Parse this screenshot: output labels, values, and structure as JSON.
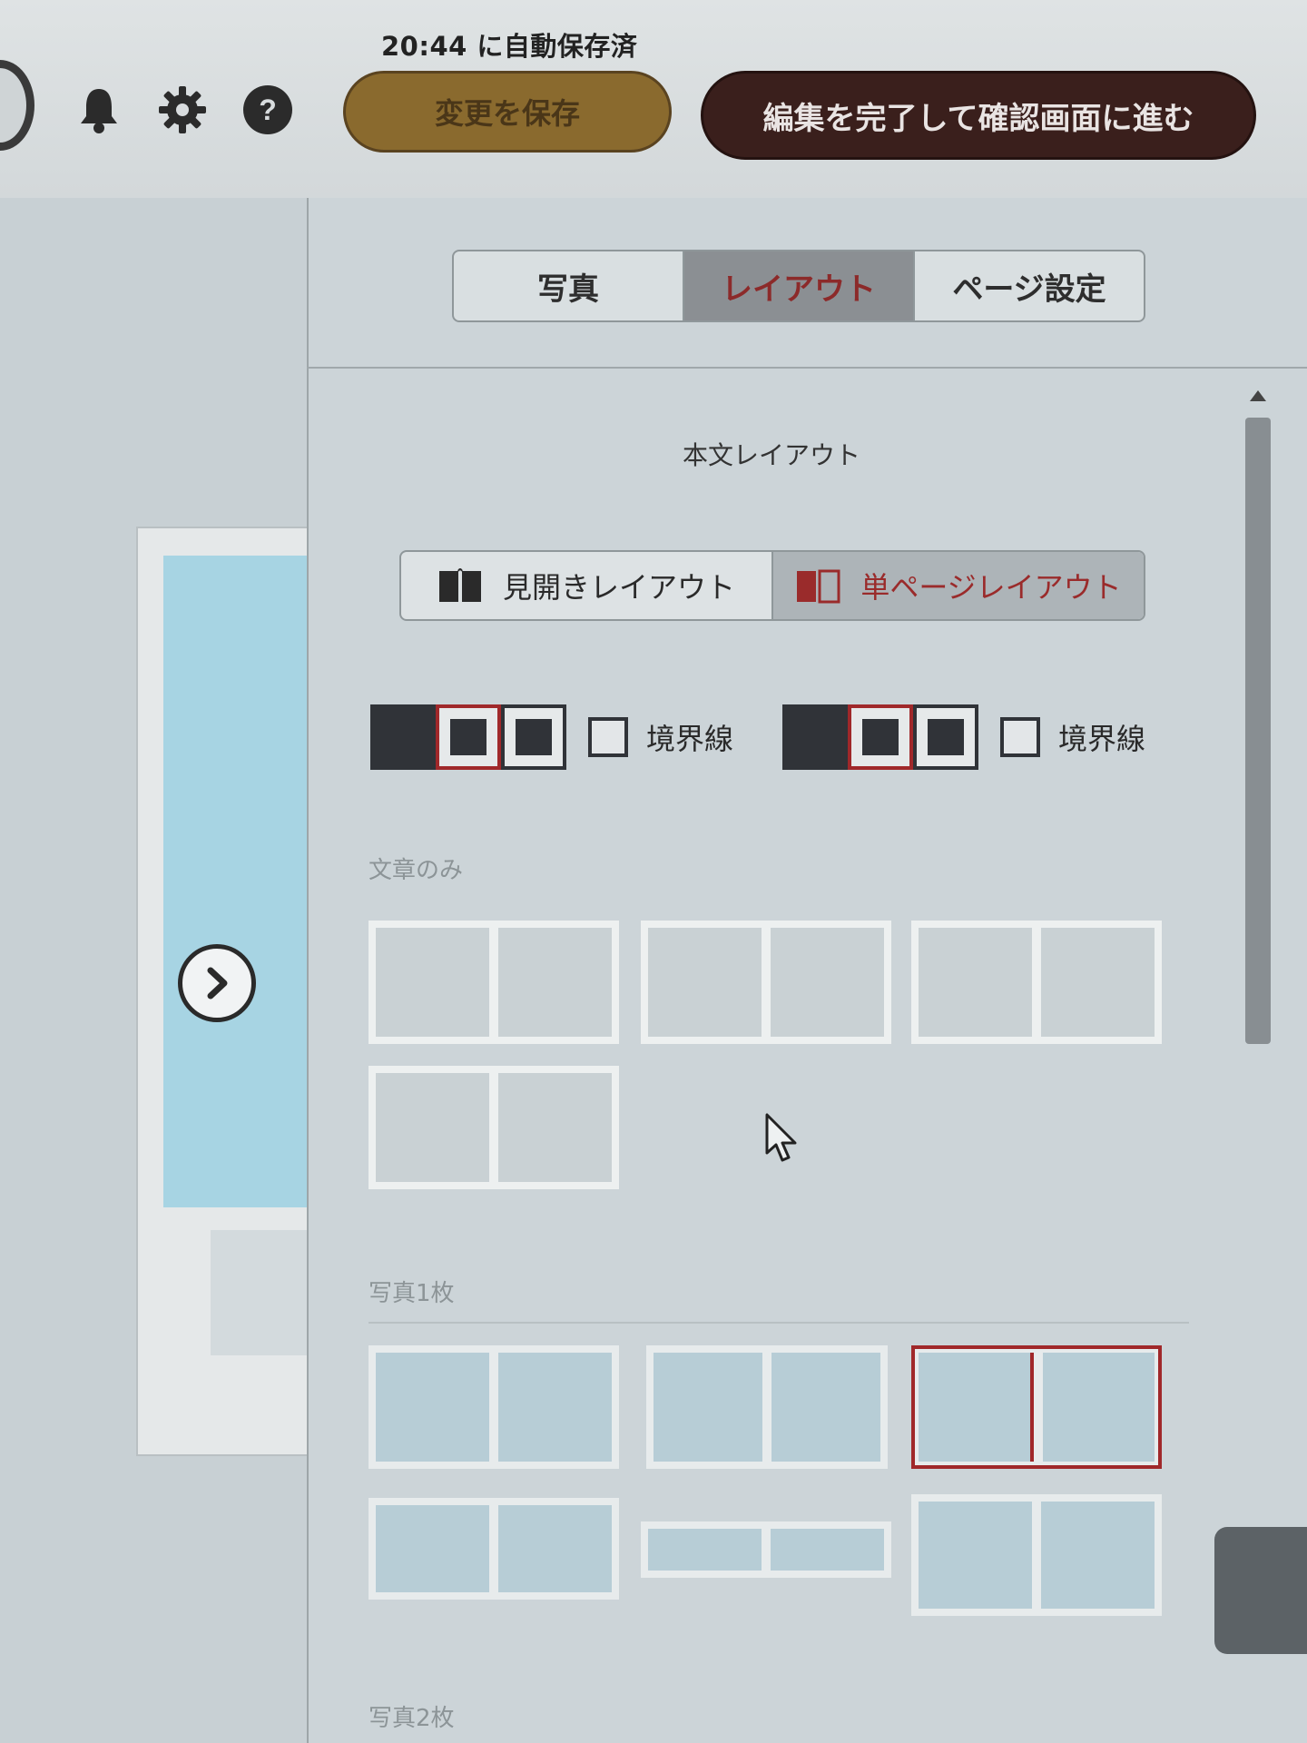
{
  "header": {
    "autosave_text": "20:44 に自動保存済",
    "save_button": "変更を保存",
    "finish_button": "編集を完了して確認画面に進む",
    "icons": [
      "bell-icon",
      "gear-icon",
      "help-icon"
    ]
  },
  "tabs": [
    {
      "label": "写真",
      "active": false
    },
    {
      "label": "レイアウト",
      "active": true
    },
    {
      "label": "ページ設定",
      "active": false
    }
  ],
  "panel": {
    "section_title": "本文レイアウト",
    "layout_modes": [
      {
        "label": "見開きレイアウト",
        "icon": "open-book-icon",
        "active": false
      },
      {
        "label": "単ページレイアウト",
        "icon": "single-page-icon",
        "active": true
      }
    ],
    "frame_options": [
      {
        "border_label": "境界線",
        "selected_frame": 1,
        "border_checked": false
      },
      {
        "border_label": "境界線",
        "selected_frame": 1,
        "border_checked": false
      }
    ],
    "groups": [
      {
        "label": "文章のみ"
      },
      {
        "label": "写真1枚"
      },
      {
        "label": "写真2枚"
      }
    ]
  },
  "colors": {
    "accent_red": "#a0282a",
    "save_button": "#8a6a2e",
    "finish_button": "#3a1f1c"
  }
}
